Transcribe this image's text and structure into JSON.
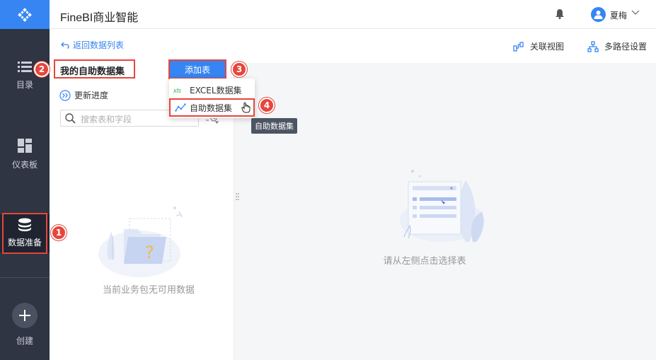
{
  "app": {
    "title": "FineBI商业智能",
    "user": "夏梅"
  },
  "nav": {
    "items": [
      {
        "label": "目录",
        "icon": "list-icon"
      },
      {
        "label": "仪表板",
        "icon": "dashboard-icon"
      },
      {
        "label": "数据准备",
        "icon": "database-icon"
      },
      {
        "label": "创建",
        "icon": "plus-icon"
      }
    ]
  },
  "toolbar": {
    "back_label": "返回数据列表",
    "relation_view": "关联视图",
    "multipath": "多路径设置"
  },
  "left_panel": {
    "title": "我的自助数据集",
    "update_label": "更新进度",
    "search_placeholder": "搜索表和字段",
    "empty_text": "当前业务包无可用数据"
  },
  "add_table": {
    "button_label": "添加表",
    "menu": [
      {
        "label": "EXCEL数据集",
        "icon": "xls-icon"
      },
      {
        "label": "自助数据集",
        "icon": "self-dataset-icon"
      }
    ],
    "tooltip": "自助数据集"
  },
  "main": {
    "empty_text": "请从左侧点击选择表"
  },
  "steps": [
    "1",
    "2",
    "3",
    "4"
  ],
  "colors": {
    "accent": "#3685f2",
    "sidebar": "#2f3542",
    "highlight": "#e6463c"
  }
}
